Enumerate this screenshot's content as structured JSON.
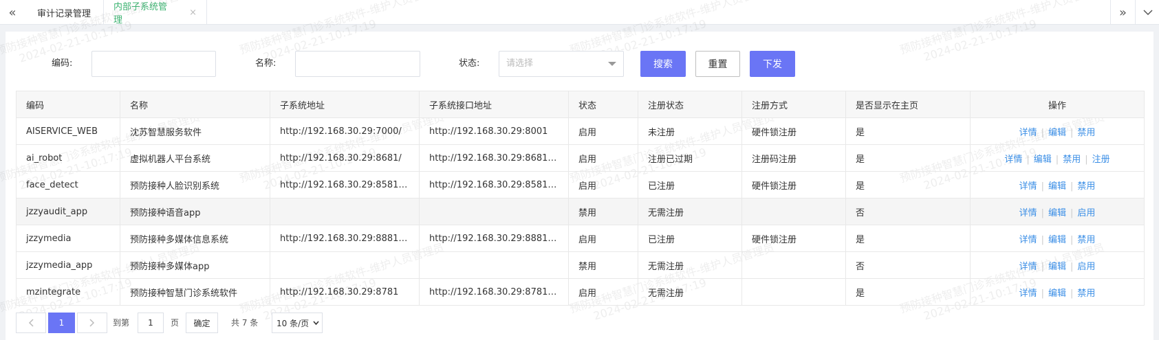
{
  "tabs": {
    "items": [
      {
        "label": "审计记录管理"
      },
      {
        "label": "内部子系统管理",
        "active": true
      }
    ],
    "close_glyph": "×",
    "icons": {
      "left": "double-chevron-left-icon",
      "right": "double-chevron-right-icon",
      "more": "chevron-down-icon"
    }
  },
  "filters": {
    "code_label": "编码:",
    "name_label": "名称:",
    "status_label": "状态:",
    "status_placeholder": "请选择",
    "search_btn": "搜索",
    "reset_btn": "重置",
    "dispatch_btn": "下发"
  },
  "table": {
    "headers": [
      "编码",
      "名称",
      "子系统地址",
      "子系统接口地址",
      "状态",
      "注册状态",
      "注册方式",
      "是否显示在主页",
      "操作"
    ],
    "rows": [
      {
        "code": "AISERVICE_WEB",
        "name": "沈苏智慧服务软件",
        "addr": "http://192.168.30.29:7000/",
        "api": "http://192.168.30.29:8001",
        "status": "启用",
        "reg_status": "未注册",
        "reg_method": "硬件锁注册",
        "show": "是",
        "ops": [
          "详情",
          "编辑",
          "禁用"
        ]
      },
      {
        "code": "ai_robot",
        "name": "虚拟机器人平台系统",
        "addr": "http://192.168.30.29:8681/",
        "api": "http://192.168.30.29:8681/o...",
        "status": "启用",
        "reg_status": "注册已过期",
        "reg_method": "注册码注册",
        "show": "是",
        "ops": [
          "详情",
          "编辑",
          "禁用",
          "注册"
        ]
      },
      {
        "code": "face_detect",
        "name": "预防接种人脸识别系统",
        "addr": "http://192.168.30.29:8581/f...",
        "api": "http://192.168.30.29:8581/f...",
        "status": "启用",
        "reg_status": "已注册",
        "reg_method": "硬件锁注册",
        "show": "是",
        "ops": [
          "详情",
          "编辑",
          "禁用"
        ]
      },
      {
        "code": "jzzyaudit_app",
        "name": "预防接种语音app",
        "addr": "",
        "api": "",
        "status": "禁用",
        "reg_status": "无需注册",
        "reg_method": "",
        "show": "否",
        "ops": [
          "详情",
          "编辑",
          "启用"
        ]
      },
      {
        "code": "jzzymedia",
        "name": "预防接种多媒体信息系统",
        "addr": "http://192.168.30.29:8881/j...",
        "api": "http://192.168.30.29:8881/j...",
        "status": "启用",
        "reg_status": "已注册",
        "reg_method": "硬件锁注册",
        "show": "是",
        "ops": [
          "详情",
          "编辑",
          "禁用"
        ]
      },
      {
        "code": "jzzymedia_app",
        "name": "预防接种多媒体app",
        "addr": "",
        "api": "",
        "status": "禁用",
        "reg_status": "无需注册",
        "reg_method": "",
        "show": "否",
        "ops": [
          "详情",
          "编辑",
          "启用"
        ]
      },
      {
        "code": "mzintegrate",
        "name": "预防接种智慧门诊系统软件",
        "addr": "http://192.168.30.29:8781",
        "api": "http://192.168.30.29:8781/o...",
        "status": "启用",
        "reg_status": "无需注册",
        "reg_method": "",
        "show": "是",
        "ops": [
          "详情",
          "编辑",
          "禁用"
        ]
      }
    ]
  },
  "pagination": {
    "current_page": "1",
    "goto_label": "到第",
    "goto_value": "1",
    "page_unit": "页",
    "confirm_btn": "确定",
    "total": "共 7 条",
    "page_size": "10 条/页"
  },
  "watermark": {
    "line1": "预防接种智慧门诊系统软件-维护人员管理员",
    "line2": "2024-02-21-10:17:19"
  },
  "colors": {
    "primary": "#6a75f5",
    "active_tab": "#3cb371",
    "link": "#3a8ee6"
  }
}
